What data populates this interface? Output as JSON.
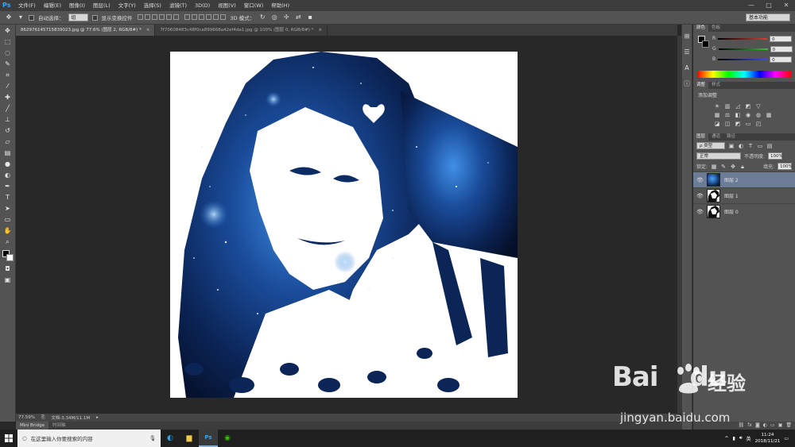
{
  "app": {
    "logo": "Ps"
  },
  "menu": [
    "文件(F)",
    "编辑(E)",
    "图像(I)",
    "图层(L)",
    "文字(Y)",
    "选择(S)",
    "滤镜(T)",
    "3D(D)",
    "视图(V)",
    "窗口(W)",
    "帮助(H)"
  ],
  "window_controls": [
    "—",
    "□",
    "✕"
  ],
  "options_bar": {
    "auto_select_label": "自动选择：",
    "auto_select_value": "组",
    "show_transform_label": "显示变换控件",
    "mode_3d_label": "3D 模式：",
    "workspace": "基本功能"
  },
  "doc_tabs": [
    {
      "label": "862976145715839023.jpg @ 77.6% (图层 2, RGB/8#) *",
      "close": "×"
    },
    {
      "label": "7f70608483c48f0ca899668a42ef4da1.jpg @ 100% (图层 0, RGB/8#) *",
      "close": "×"
    }
  ],
  "status": {
    "zoom": "77.59%",
    "doc_size": "文档:3.34M/11.1M"
  },
  "bottom_tabs": [
    "Mini Bridge",
    "时间轴"
  ],
  "panels": {
    "color_tabs": [
      "颜色",
      "色板"
    ],
    "color": {
      "channels": [
        {
          "label": "R",
          "value": "0",
          "color": "#e23b3b"
        },
        {
          "label": "G",
          "value": "0",
          "color": "#35c23a"
        },
        {
          "label": "B",
          "value": "0",
          "color": "#3b4fe2"
        }
      ]
    },
    "adjust_tabs": [
      "调整",
      "样式"
    ],
    "adjust_title": "添加调整",
    "layers_tabs": [
      "图层",
      "通道",
      "路径"
    ],
    "layer_filter": "ρ 类型",
    "blend_mode": "正常",
    "opacity_label": "不透明度:",
    "opacity_value": "100%",
    "lock_label": "锁定:",
    "fill_label": "填充:",
    "fill_value": "100%",
    "layers": [
      {
        "name": "图层 2",
        "selected": true,
        "thumb": "space"
      },
      {
        "name": "图层 1",
        "selected": false,
        "thumb": "bw"
      },
      {
        "name": "图层 0",
        "selected": false,
        "thumb": "bw"
      }
    ]
  },
  "taskbar": {
    "search_placeholder": "在这里输入你要搜索的内容",
    "time": "11:24",
    "date": "2018/11/21",
    "ime": "英"
  },
  "watermark": {
    "brand": "Bai",
    "brand2": "du",
    "cn": "经验",
    "url": "jingyan.baidu.com"
  }
}
